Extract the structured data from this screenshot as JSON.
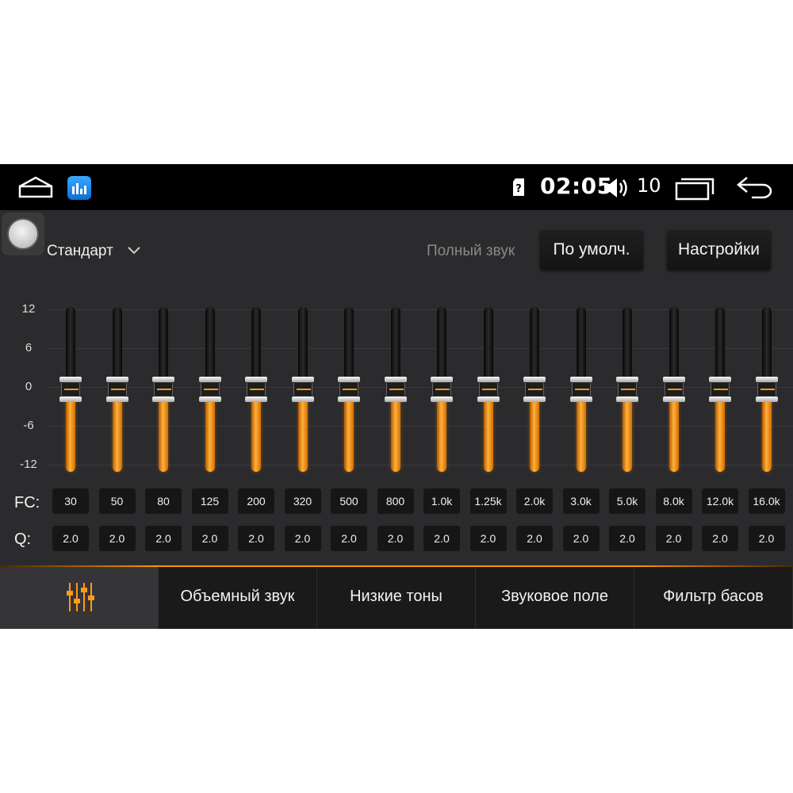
{
  "status_bar": {
    "time": "02:05",
    "volume_level": "10",
    "icons": [
      "home-icon",
      "app-equalizer-icon",
      "sim-icon",
      "volume-icon",
      "recent-apps-icon",
      "back-icon"
    ]
  },
  "header": {
    "preset": "Стандарт",
    "loudness_label": "Полный звук",
    "default_button": "По умолч.",
    "settings_button": "Настройки"
  },
  "equalizer": {
    "scale": [
      "12",
      "6",
      "0",
      "-6",
      "-12"
    ],
    "fc_label": "FC:",
    "q_label": "Q:",
    "gain_range_db": [
      -12,
      12
    ],
    "bands": [
      {
        "fc": "30",
        "q": "2.0",
        "gain": 0
      },
      {
        "fc": "50",
        "q": "2.0",
        "gain": 0
      },
      {
        "fc": "80",
        "q": "2.0",
        "gain": 0
      },
      {
        "fc": "125",
        "q": "2.0",
        "gain": 0
      },
      {
        "fc": "200",
        "q": "2.0",
        "gain": 0
      },
      {
        "fc": "320",
        "q": "2.0",
        "gain": 0
      },
      {
        "fc": "500",
        "q": "2.0",
        "gain": 0
      },
      {
        "fc": "800",
        "q": "2.0",
        "gain": 0
      },
      {
        "fc": "1.0k",
        "q": "2.0",
        "gain": 0
      },
      {
        "fc": "1.25k",
        "q": "2.0",
        "gain": 0
      },
      {
        "fc": "2.0k",
        "q": "2.0",
        "gain": 0
      },
      {
        "fc": "3.0k",
        "q": "2.0",
        "gain": 0
      },
      {
        "fc": "5.0k",
        "q": "2.0",
        "gain": 0
      },
      {
        "fc": "8.0k",
        "q": "2.0",
        "gain": 0
      },
      {
        "fc": "12.0k",
        "q": "2.0",
        "gain": 0
      },
      {
        "fc": "16.0k",
        "q": "2.0",
        "gain": 0
      }
    ]
  },
  "bottom_tabs": [
    {
      "label": "",
      "icon": "equalizer-icon",
      "active": true
    },
    {
      "label": "Объемный звук",
      "active": false
    },
    {
      "label": "Низкие тоны",
      "active": false
    },
    {
      "label": "Звуковое поле",
      "active": false
    },
    {
      "label": "Фильтр басов",
      "active": false
    }
  ],
  "colors": {
    "accent": "#ff9a1a",
    "background": "#2b2b2d",
    "status_bar": "#000000"
  }
}
